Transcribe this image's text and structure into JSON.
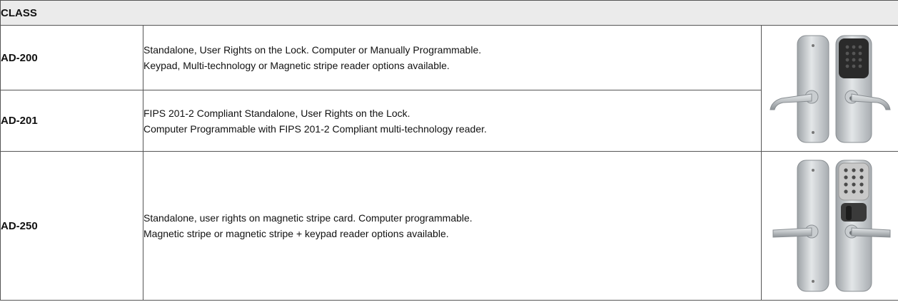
{
  "table": {
    "header": "CLASS",
    "rows": [
      {
        "class": "AD-200",
        "lines": [
          "Standalone, User Rights on the Lock. Computer or Manually Programmable.",
          "Keypad, Multi-technology or Magnetic stripe reader options available."
        ]
      },
      {
        "class": "AD-201",
        "lines": [
          "FIPS 201-2 Compliant Standalone, User Rights on the Lock.",
          "Computer Programmable with FIPS 201-2 Compliant multi-technology reader."
        ]
      },
      {
        "class": "AD-250",
        "lines": [
          "Standalone, user rights on magnetic stripe card. Computer programmable.",
          "Magnetic stripe or magnetic stripe + keypad reader options available."
        ]
      }
    ],
    "images": [
      {
        "icon": "keypad-lever-lock-icon",
        "keypad_color": "#2a2a2a"
      },
      {
        "icon": "keypad-magstripe-lever-lock-icon",
        "keypad_color": "#c9c9c9"
      }
    ]
  }
}
